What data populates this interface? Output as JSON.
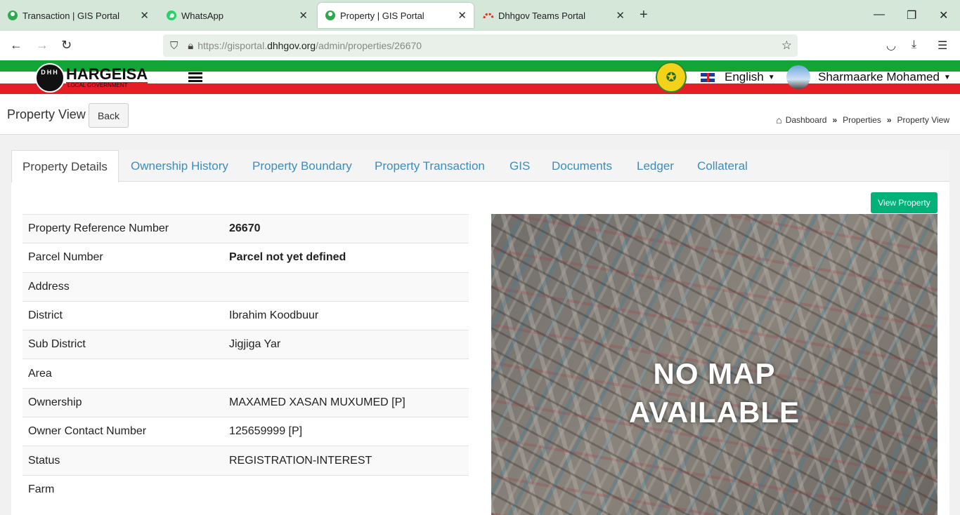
{
  "browser": {
    "tabs": [
      {
        "title": "Transaction | GIS Portal",
        "icon": "gis-portal-icon"
      },
      {
        "title": "WhatsApp",
        "icon": "whatsapp-icon"
      },
      {
        "title": "Property | GIS Portal",
        "icon": "gis-portal-icon",
        "active": true
      },
      {
        "title": "Dhhgov Teams Portal",
        "icon": "teams-portal-icon"
      }
    ],
    "url_prefix": "https://gisportal.",
    "url_domain": "dhhgov.org",
    "url_path": "/admin/properties/26670"
  },
  "site": {
    "logo_text": "HARGEISA",
    "logo_subtext": "LOCAL GOVERNMENT",
    "logo_badge": "DHH",
    "language": "English",
    "user_name": "Sharmaarke Mohamed"
  },
  "page": {
    "title": "Property View",
    "back_label": "Back",
    "breadcrumb": [
      "Dashboard",
      "Properties",
      "Property View"
    ]
  },
  "tabs": [
    "Property Details",
    "Ownership History",
    "Property Boundary",
    "Property Transaction",
    "GIS",
    "Documents",
    "Ledger",
    "Collateral"
  ],
  "view_property_label": "View Property",
  "details": [
    {
      "label": "Property Reference Number",
      "value": "26670"
    },
    {
      "label": "Parcel Number",
      "value": "Parcel not yet defined"
    },
    {
      "label": "Address",
      "value": ""
    },
    {
      "label": "District",
      "value": "Ibrahim Koodbuur"
    },
    {
      "label": "Sub District",
      "value": "Jigjiga Yar"
    },
    {
      "label": "Area",
      "value": ""
    },
    {
      "label": "Ownership",
      "value": "MAXAMED XASAN MUXUMED [P]"
    },
    {
      "label": "Owner Contact Number",
      "value": "125659999 [P]"
    },
    {
      "label": "Status",
      "value": "REGISTRATION-INTEREST"
    },
    {
      "label": "Farm",
      "value": ""
    }
  ],
  "map": {
    "line1": "NO MAP",
    "line2": "AVAILABLE"
  },
  "colors": {
    "accent": "#3c8dbc",
    "green_button": "#00b277",
    "flag_green": "#13a538",
    "flag_red": "#e31e26"
  }
}
